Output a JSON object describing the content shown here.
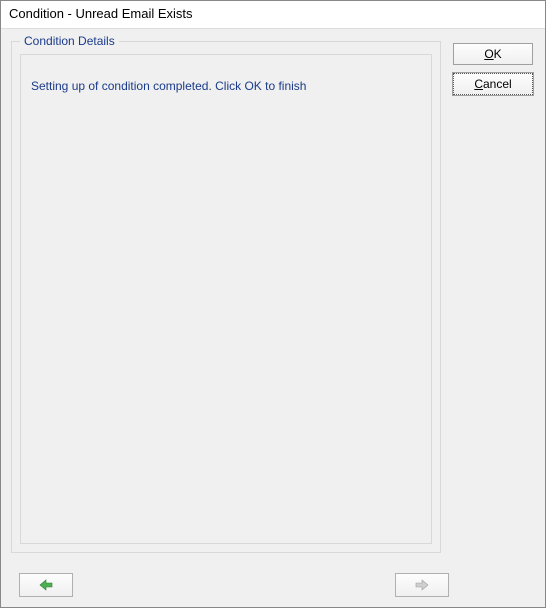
{
  "window": {
    "title": "Condition - Unread Email  Exists"
  },
  "fieldset": {
    "legend": "Condition Details",
    "message": "Setting up of condition completed. Click OK to finish"
  },
  "buttons": {
    "ok_prefix": "O",
    "ok_suffix": "K",
    "cancel_prefix": "C",
    "cancel_suffix": "ancel"
  }
}
